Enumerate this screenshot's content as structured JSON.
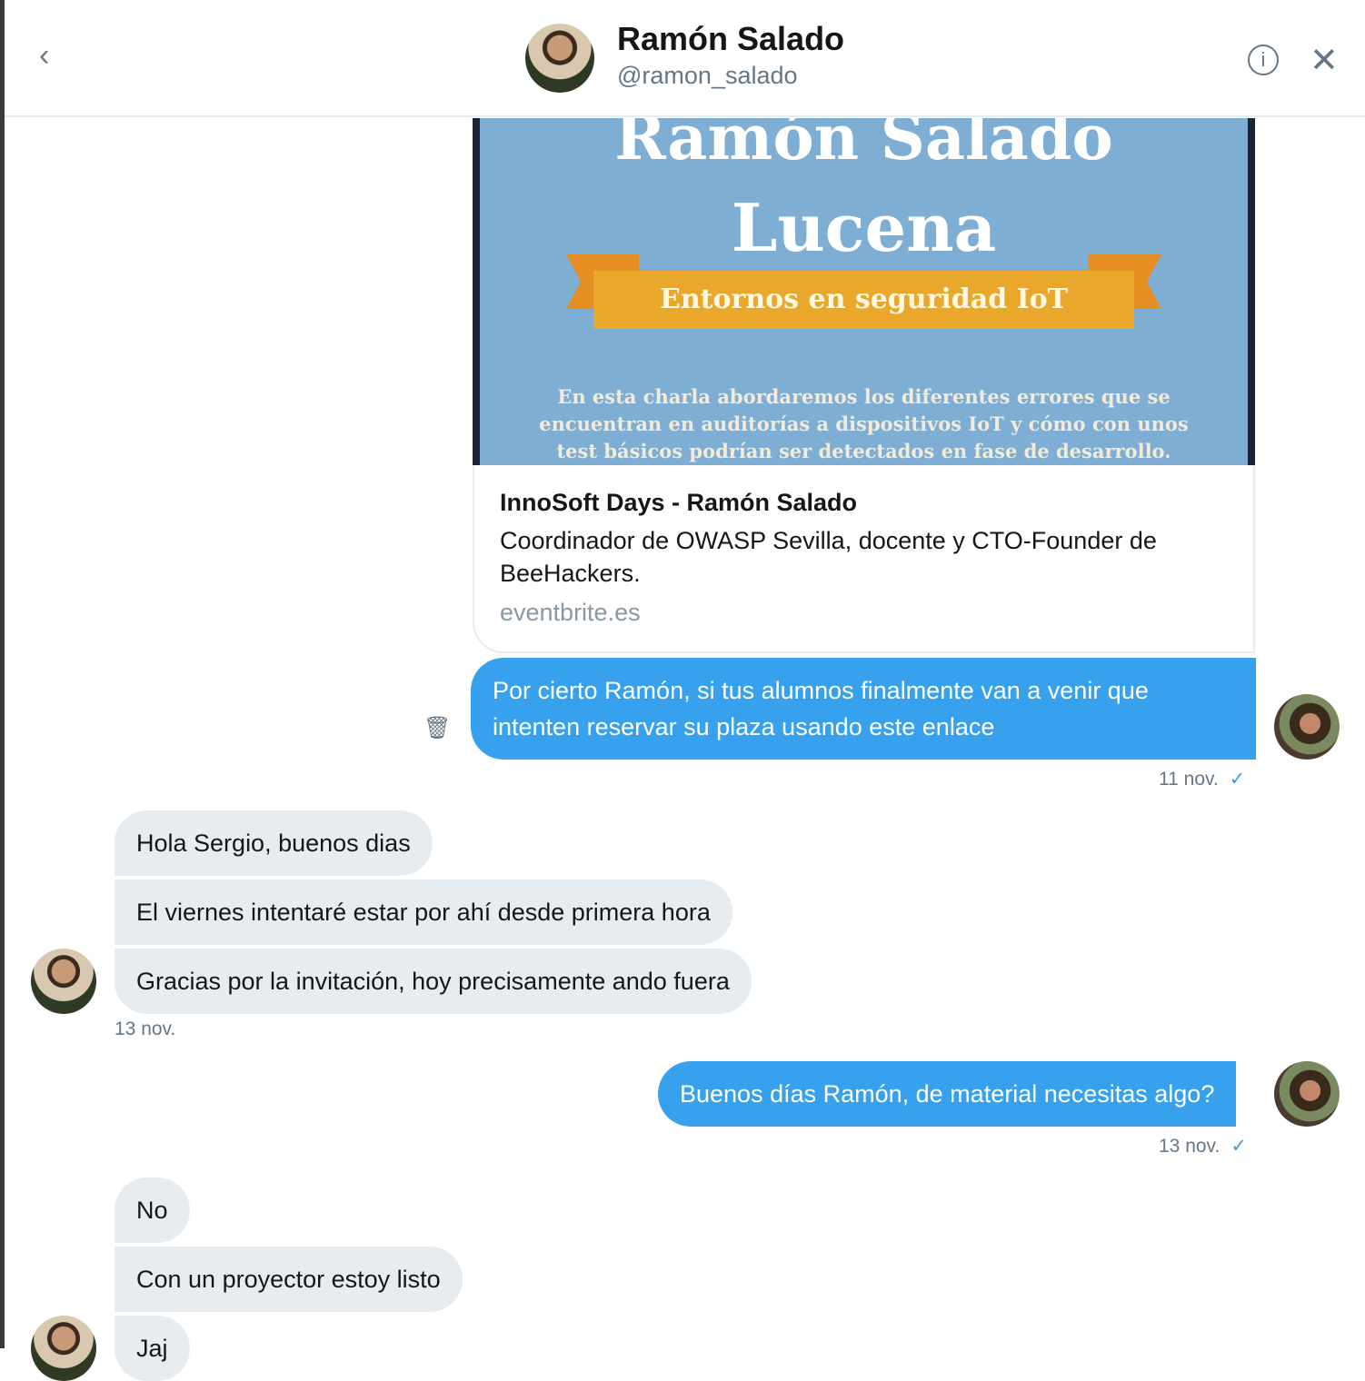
{
  "header": {
    "name": "Ramón Salado",
    "handle": "@ramon_salado"
  },
  "card": {
    "image_title_line1": "Ramón Salado",
    "image_title_line2": "Lucena",
    "image_ribbon": "Entornos en seguridad IoT",
    "image_desc": "En esta charla abordaremos los diferentes errores que se encuentran en auditorías a dispositivos IoT y cómo con unos test básicos podrían ser detectados en fase de desarrollo.",
    "title": "InnoSoft Days - Ramón Salado",
    "description": "Coordinador de OWASP Sevilla, docente y CTO-Founder de BeeHackers.",
    "domain": "eventbrite.es"
  },
  "messages": [
    {
      "text": "Por cierto Ramón, si tus alumnos finalmente van a venir que intenten reservar su plaza usando este enlace",
      "time": "11 nov.",
      "check": "✓"
    },
    {
      "text": "Hola Sergio, buenos dias"
    },
    {
      "text": "El viernes intentaré estar por ahí desde primera hora"
    },
    {
      "text": "Gracias por la invitación, hoy precisamente ando fuera",
      "time": "13 nov."
    },
    {
      "text": "Buenos días Ramón, de material necesitas algo?",
      "time": "13 nov.",
      "check": "✓"
    },
    {
      "text": "No"
    },
    {
      "text": "Con un proyector estoy listo"
    },
    {
      "text": "Jaj"
    }
  ],
  "icons": {
    "back": "‹",
    "info": "i",
    "close": "✕",
    "trash": "🗑"
  }
}
